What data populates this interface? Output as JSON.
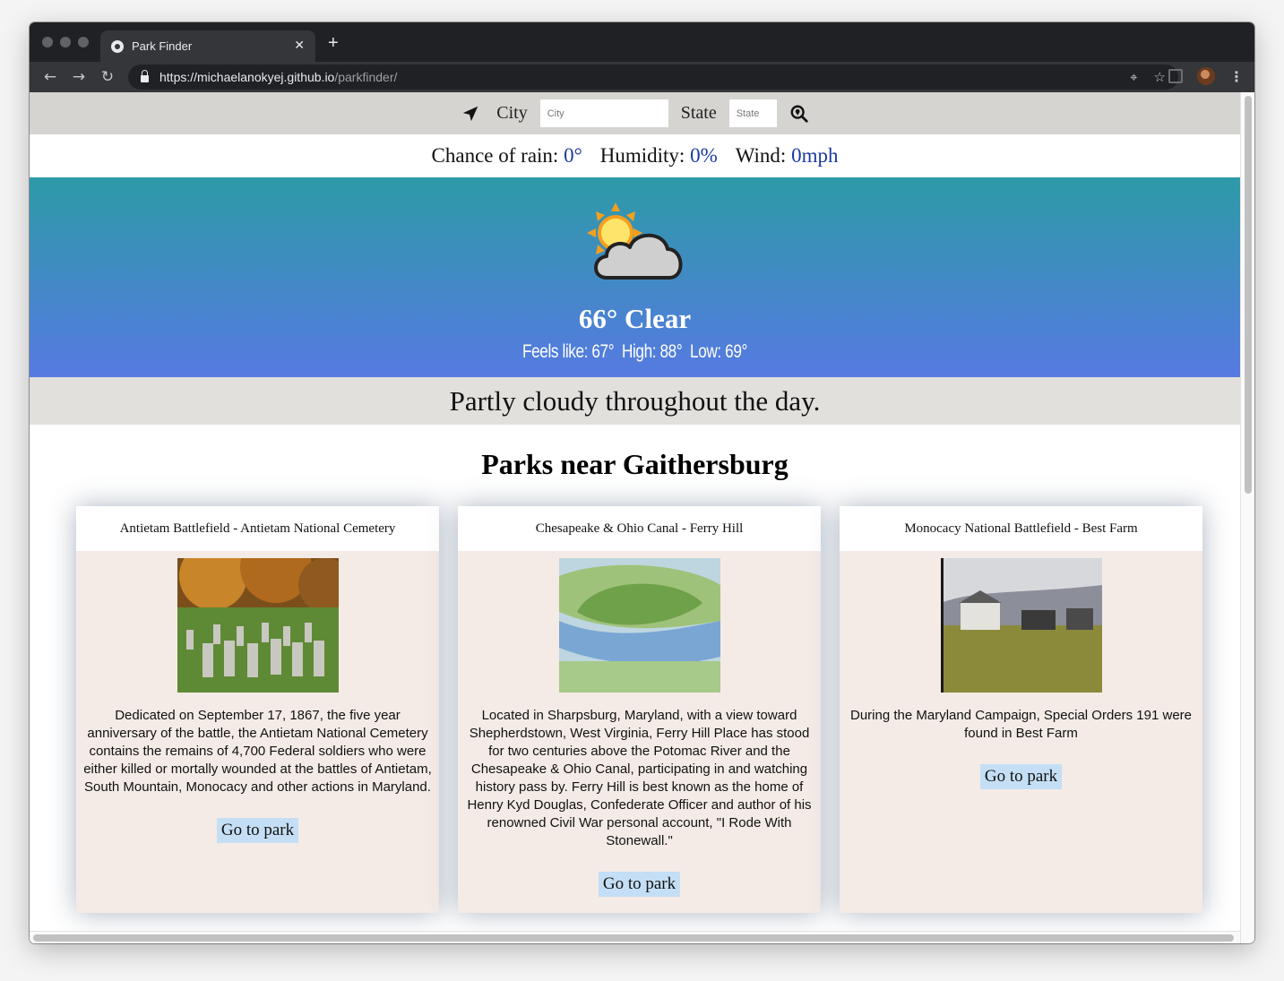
{
  "browser": {
    "tab_title": "Park Finder",
    "tab_close": "✕",
    "new_tab": "+",
    "url_host": "https://michaelanokyej.github.io",
    "url_path": "/parkfinder/"
  },
  "search": {
    "city_label": "City",
    "city_placeholder": "City",
    "state_label": "State",
    "state_placeholder": "State"
  },
  "conditions": {
    "rain_label": "Chance of rain:",
    "rain_value": "0°",
    "humidity_label": "Humidity:",
    "humidity_value": "0%",
    "wind_label": "Wind:",
    "wind_value": "0mph"
  },
  "weather": {
    "icon": "partly-cloudy-icon",
    "headline": "66° Clear",
    "feels_like": "Feels like: 67°",
    "high": "High: 88°",
    "low": "Low: 69°",
    "summary": "Partly cloudy throughout the day."
  },
  "parks": {
    "title": "Parks near Gaithersburg",
    "items": [
      {
        "name": "Antietam Battlefield - Antietam National Cemetery",
        "description": "Dedicated on September 17, 1867, the five year anniversary of the battle, the Antietam National Cemetery contains the remains of 4,700 Federal soldiers who were either killed or mortally wounded at the battles of Antietam, South Mountain, Monocacy and other actions in Maryland.",
        "button": "Go to park"
      },
      {
        "name": "Chesapeake & Ohio Canal - Ferry Hill",
        "description": "Located in Sharpsburg, Maryland, with a view toward Shepherdstown, West Virginia, Ferry Hill Place has stood for two centuries above the Potomac River and the Chesapeake & Ohio Canal, participating in and watching history pass by. Ferry Hill is best known as the home of Henry Kyd Douglas, Confederate Officer and author of his renowned Civil War personal account, \"I Rode With Stonewall.\"",
        "button": "Go to park"
      },
      {
        "name": "Monocacy National Battlefield - Best Farm",
        "description": "During the Maryland Campaign, Special Orders 191 were found in Best Farm",
        "button": "Go to park"
      }
    ]
  }
}
